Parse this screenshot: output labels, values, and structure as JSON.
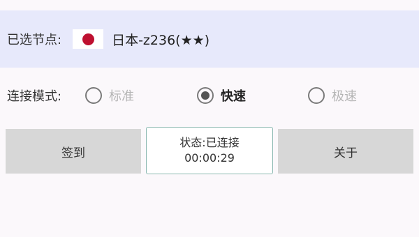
{
  "node": {
    "label": "已选节点:",
    "flag_icon": "japan-flag-icon",
    "name": "日本-z236(★★)"
  },
  "mode": {
    "label": "连接模式:",
    "options": [
      {
        "label": "标准",
        "checked": false
      },
      {
        "label": "快速",
        "checked": true
      },
      {
        "label": "极速",
        "checked": false
      }
    ]
  },
  "actions": {
    "checkin_label": "签到",
    "about_label": "关于"
  },
  "status": {
    "text": "状态:已连接",
    "time": "00:00:29"
  },
  "colors": {
    "node_bar_bg": "#e7e9fb",
    "flag_red": "#be1030",
    "button_bg": "#d7d7d7",
    "status_border": "#8ab8b0"
  }
}
